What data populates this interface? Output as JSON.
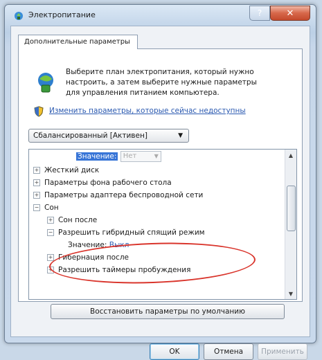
{
  "window": {
    "title": "Электропитание",
    "help_label": "?",
    "close_label": "✕"
  },
  "tab": {
    "label": "Дополнительные параметры"
  },
  "intro": {
    "description": "Выберите план электропитания, который нужно настроить, а затем выберите нужные параметры для управления питанием компьютера.",
    "change_link": "Изменить параметры, которые сейчас недоступны"
  },
  "plan_select": {
    "value": "Сбалансированный [Активен]"
  },
  "tree": {
    "top_value_label": "Значение:",
    "top_value_select": "Нет",
    "items": [
      {
        "label": "Жесткий диск",
        "expander": "+"
      },
      {
        "label": "Параметры фона рабочего стола",
        "expander": "+"
      },
      {
        "label": "Параметры адаптера беспроводной сети",
        "expander": "+"
      },
      {
        "label": "Сон",
        "expander": "−"
      },
      {
        "label": "Сон после",
        "expander": "+"
      },
      {
        "label": "Разрешить гибридный спящий режим",
        "expander": "−"
      },
      {
        "label": "Гибернация после",
        "expander": "+"
      },
      {
        "label": "Разрешить таймеры пробуждения",
        "expander": "+"
      }
    ],
    "hybrid_value_label": "Значение:",
    "hybrid_value": "Выкл"
  },
  "buttons": {
    "restore_defaults": "Восстановить параметры по умолчанию",
    "ok": "OK",
    "cancel": "Отмена",
    "apply": "Применить"
  },
  "colors": {
    "accent": "#3875d7",
    "link": "#2a59b0",
    "highlight": "#d9342b"
  }
}
